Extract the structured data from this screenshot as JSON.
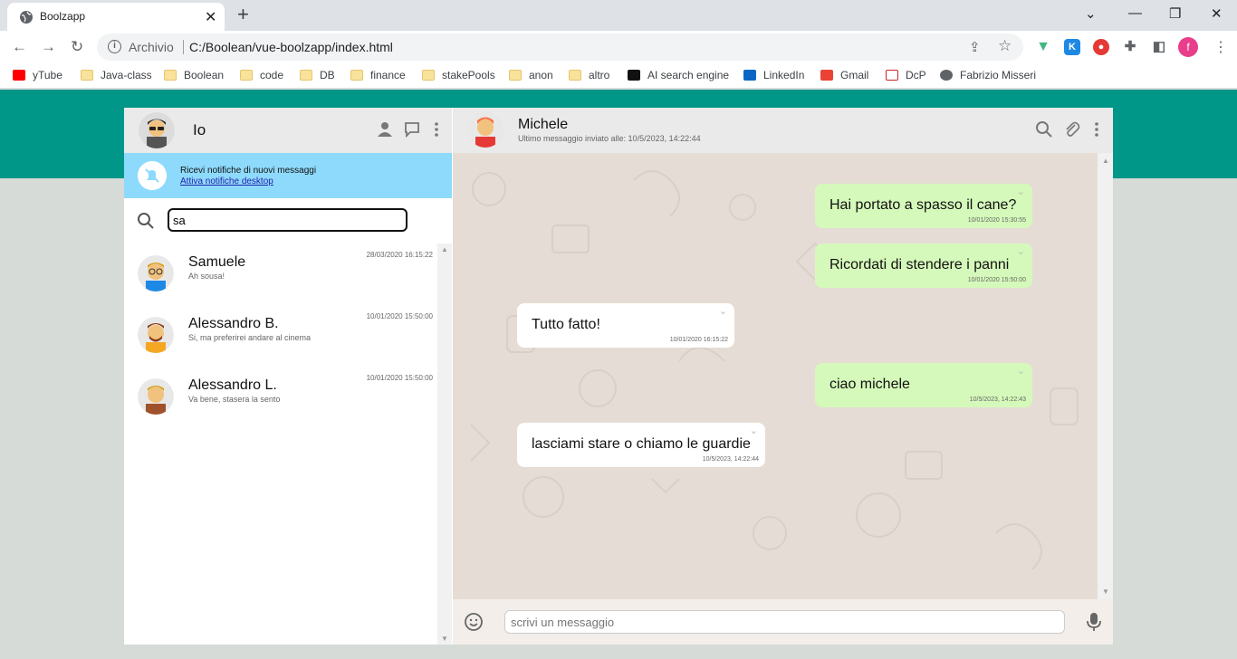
{
  "browser": {
    "tab_title": "Boolzapp",
    "tab_close": "✕",
    "new_tab": "+",
    "omnibox_label": "Archivio",
    "url": "C:/Boolean/vue-boolzapp/index.html",
    "profile_initial": "f",
    "bookmarks": [
      "yTube",
      "Java-class",
      "Boolean",
      "code",
      "DB",
      "finance",
      "stakePools",
      "anon",
      "altro",
      "AI search engine",
      "LinkedIn",
      "Gmail",
      "DcP",
      "Fabrizio Misseri"
    ]
  },
  "app": {
    "user_name": "Io",
    "notification": {
      "text": "Ricevi notifiche di nuovi messaggi",
      "link": "Attiva notifiche desktop"
    },
    "search_value": "sa",
    "contacts": [
      {
        "name": "Samuele",
        "last_message": "Ah sousa!",
        "time": "28/03/2020 16:15:22"
      },
      {
        "name": "Alessandro B.",
        "last_message": "Si, ma preferirei andare al cinema",
        "time": "10/01/2020 15:50:00"
      },
      {
        "name": "Alessandro L.",
        "last_message": "Va bene, stasera la sento",
        "time": "10/01/2020 15:50:00"
      }
    ],
    "active_chat": {
      "name": "Michele",
      "last_seen": "Ultimo messaggio inviato alle: 10/5/2023, 14:22:44",
      "messages": [
        {
          "text": "Hai portato a spasso il cane?",
          "time": "10/01/2020 15:30:55",
          "type": "sent"
        },
        {
          "text": "Ricordati di stendere i panni",
          "time": "10/01/2020 15:50:00",
          "type": "sent"
        },
        {
          "text": "Tutto fatto!",
          "time": "10/01/2020 16:15:22",
          "type": "received"
        },
        {
          "text": "ciao michele",
          "time": "10/5/2023, 14:22:43",
          "type": "sent"
        },
        {
          "text": "lasciami stare o chiamo le guardie",
          "time": "10/5/2023, 14:22:44",
          "type": "received"
        }
      ]
    },
    "input_placeholder": "scrivi un messaggio"
  },
  "colors": {
    "header_green": "#009688",
    "sent_bubble": "#d5f9ba",
    "notification_bg": "#8edafc"
  }
}
